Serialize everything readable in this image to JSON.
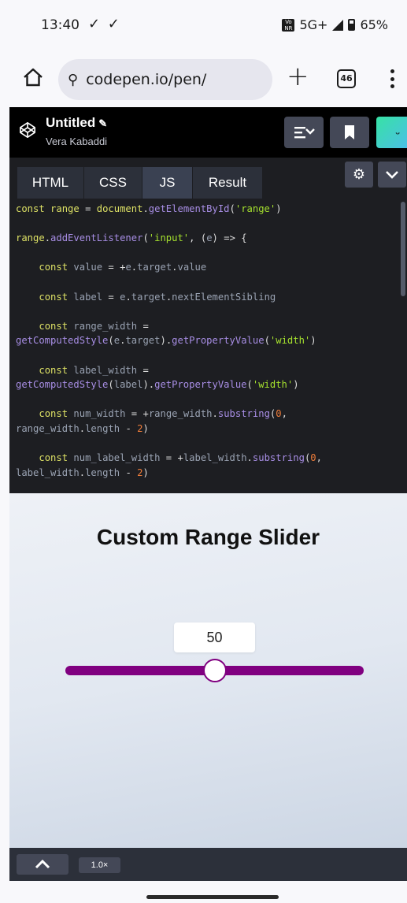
{
  "status_bar": {
    "time": "13:40",
    "check_icons": "✓ ✓",
    "vonr_badge": "Vo NR",
    "network": "5G+",
    "battery": "65%"
  },
  "browser": {
    "url_text": "codepen.io/pen/",
    "tab_count": "46",
    "new_tab_label": "+"
  },
  "codepen_header": {
    "title": "Untitled",
    "author": "Vera Kabaddi"
  },
  "editor": {
    "tabs": [
      {
        "label": "HTML"
      },
      {
        "label": "CSS"
      },
      {
        "label": "JS"
      },
      {
        "label": "Result"
      }
    ],
    "active_tab": "JS"
  },
  "code_lines": [
    "const range = document.getElementById('range')",
    "",
    "range.addEventListener('input', (e) => {",
    "",
    "    const value = +e.target.value",
    "",
    "    const label = e.target.nextElementSibling",
    "",
    "    const range_width =",
    "getComputedStyle(e.target).getPropertyValue('width')",
    "",
    "    const label_width =",
    "getComputedStyle(label).getPropertyValue('width')",
    "",
    "    const num_width = +range_width.substring(0,",
    "range_width.length - 2)",
    "",
    "    const num_label_width = +label_width.substring(0,",
    "label_width.length - 2)"
  ],
  "result": {
    "title": "Custom Range Slider",
    "range_value": "50",
    "range_min": 0,
    "range_max": 100,
    "range_fraction": 0.5,
    "slider_color": "#800080"
  },
  "footer": {
    "zoom": "1.0×"
  },
  "colors": {
    "codepen_bg": "#000000",
    "editor_bg": "#1d1e22",
    "tab_bg": "#2c303a",
    "button_bg": "#444857",
    "keyword": "#dde165",
    "function": "#a88ee5",
    "string": "#a6e22e",
    "number": "#ef7d3a"
  }
}
